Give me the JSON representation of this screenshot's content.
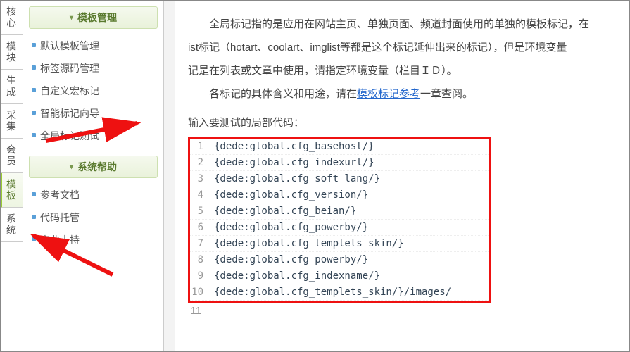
{
  "vtabs": [
    {
      "id": "core",
      "label": "核心"
    },
    {
      "id": "module",
      "label": "模块"
    },
    {
      "id": "generate",
      "label": "生成"
    },
    {
      "id": "collect",
      "label": "采集"
    },
    {
      "id": "member",
      "label": "会员"
    },
    {
      "id": "template",
      "label": "模板",
      "active": true
    },
    {
      "id": "system",
      "label": "系统"
    }
  ],
  "groups": [
    {
      "title": "模板管理",
      "items": [
        "默认模板管理",
        "标签源码管理",
        "自定义宏标记",
        "智能标记向导",
        "全局标记测试"
      ]
    },
    {
      "title": "系统帮助",
      "items": [
        "参考文档",
        "代码托管",
        "商业支持"
      ]
    }
  ],
  "content": {
    "p1a": "全局标记指的是应用在网站主页、单独页面、频道封面使用的单独的模板标记，在",
    "p1b": "ist标记（hotart、coolart、imglist等都是这个标记延伸出来的标记），但是环境变量",
    "p1c": "记是在列表或文章中使用，请指定环境变量（栏目ＩＤ）。",
    "p2a": "各标记的具体含义和用途，请在",
    "p2link": "模板标记参考",
    "p2b": "一章查阅。",
    "prompt": "输入要测试的局部代码："
  },
  "code": [
    "{dede:global.cfg_basehost/}",
    "{dede:global.cfg_indexurl/}",
    "{dede:global.cfg_soft_lang/}",
    "{dede:global.cfg_version/}",
    "{dede:global.cfg_beian/}",
    "{dede:global.cfg_powerby/}",
    "{dede:global.cfg_templets_skin/}",
    "{dede:global.cfg_powerby/}",
    "{dede:global.cfg_indexname/}",
    "{dede:global.cfg_templets_skin/}/images/"
  ]
}
